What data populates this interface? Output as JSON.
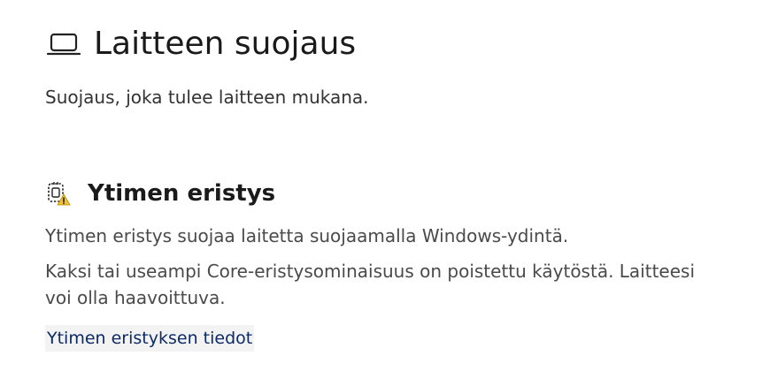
{
  "header": {
    "icon": "laptop-icon",
    "title": "Laitteen suojaus",
    "subtitle": "Suojaus, joka tulee laitteen mukana."
  },
  "core_isolation": {
    "icon": "core-isolation-warning-icon",
    "title": "Ytimen eristys",
    "description": "Ytimen eristys suojaa laitetta suojaamalla Windows-ydintä.",
    "warning": "Kaksi tai useampi Core-eristysominaisuus on poistettu käytöstä.  Laitteesi voi olla haavoittuva.",
    "link_label": "Ytimen eristyksen tiedot"
  },
  "colors": {
    "link": "#0b2a66",
    "warning_badge": "#f2c12e",
    "text": "#1a1a1a",
    "muted_text": "#4a4a4a"
  }
}
